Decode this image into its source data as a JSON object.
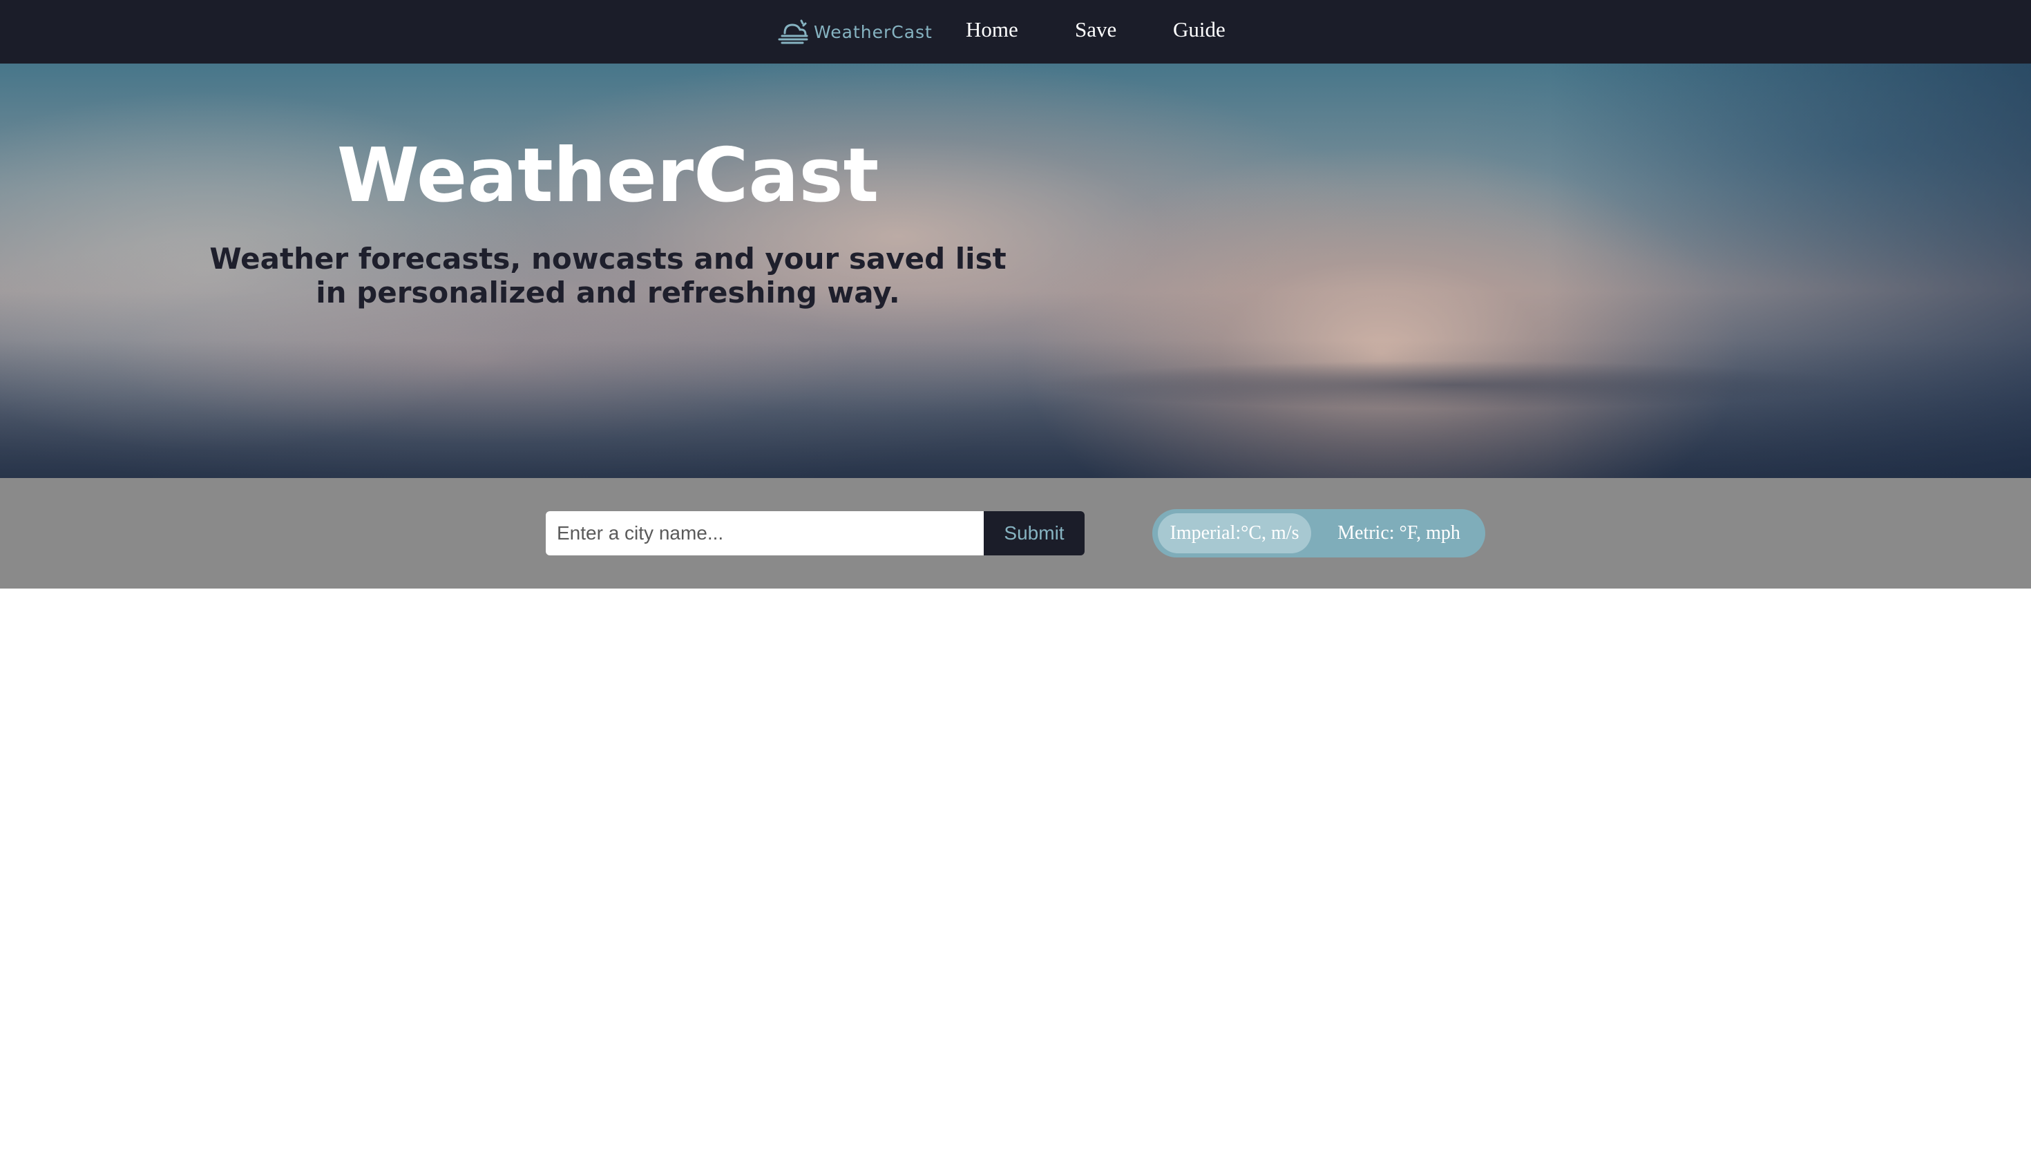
{
  "nav": {
    "brand_name": "WeatherCast",
    "brand_icon": "sun-cloud-icon",
    "links": [
      "Home",
      "Save",
      "Guide"
    ]
  },
  "hero": {
    "title": "WeatherCast",
    "subtitle": "Weather forecasts, nowcasts and your saved list in personalized and refreshing way."
  },
  "search": {
    "placeholder": "Enter a city name...",
    "value": "",
    "submit_label": "Submit"
  },
  "units": {
    "options": [
      "Imperial:°C, m/s",
      "Metric: °F, mph"
    ],
    "selected": "Imperial:°C, m/s"
  },
  "colors": {
    "navbar_bg": "#1b1d29",
    "brand_accent": "#86b3c1",
    "search_section_bg": "#8a8a8a",
    "toggle_bg": "#7fadba",
    "toggle_selected_bg": "#a7c8d1",
    "subtitle_text": "#1e1f2c"
  }
}
